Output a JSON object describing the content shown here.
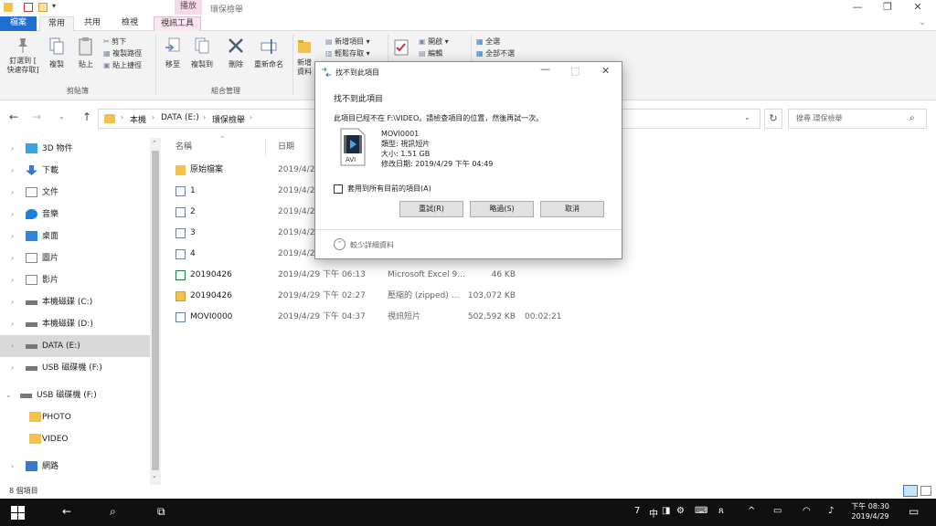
{
  "window": {
    "context_header": "播放",
    "title": "環保檢舉",
    "controls": [
      "—",
      "❐",
      "✕"
    ]
  },
  "ribbon_tabs": [
    "檔案",
    "常用",
    "共用",
    "檢視",
    "視訊工具"
  ],
  "ribbon": {
    "clipboard": {
      "pin_label": "釘選到 [\n快速存取]",
      "copy_label": "複製",
      "paste_label": "貼上",
      "cut_label": "剪下",
      "copy_path_label": "複製路徑",
      "paste_shortcut_label": "貼上捷徑",
      "group_label": "剪貼簿"
    },
    "organize": {
      "move_label": "移至",
      "copyto_label": "複製到",
      "delete_label": "刪除",
      "rename_label": "重新命名",
      "group_label": "組合管理"
    },
    "new": {
      "new_folder_label": "新增\n資料",
      "new_item_label": "新增項目 ▾",
      "easy_access_label": "輕鬆存取 ▾"
    },
    "open": {
      "open_label": "開啟 ▾",
      "edit_label": "編輯"
    },
    "select": {
      "select_all_label": "全選",
      "select_none_label": "全部不選"
    }
  },
  "address": {
    "path": [
      "本機",
      "DATA (E:)",
      "環保檢舉"
    ],
    "search_placeholder": "搜尋 環保檢舉"
  },
  "nav": [
    {
      "label": "3D 物件",
      "icon": "cube-icon",
      "sel": false
    },
    {
      "label": "下載",
      "icon": "download-icon",
      "sel": false
    },
    {
      "label": "文件",
      "icon": "document-icon",
      "sel": false
    },
    {
      "label": "音樂",
      "icon": "music-icon",
      "sel": false
    },
    {
      "label": "桌面",
      "icon": "desktop-icon",
      "sel": false
    },
    {
      "label": "圖片",
      "icon": "pictures-icon",
      "sel": false
    },
    {
      "label": "影片",
      "icon": "video-icon",
      "sel": false
    },
    {
      "label": "本機磁碟 (C:)",
      "icon": "drive-icon",
      "sel": false
    },
    {
      "label": "本機磁碟 (D:)",
      "icon": "drive-icon",
      "sel": false
    },
    {
      "label": "DATA (E:)",
      "icon": "drive-icon",
      "sel": true
    },
    {
      "label": "USB 磁碟機 (F:)",
      "icon": "usb-drive-icon",
      "sel": false
    },
    {
      "label": "USB 磁碟機 (F:)",
      "icon": "usb-drive-icon",
      "sel": false
    },
    {
      "label": "PHOTO",
      "icon": "folder-icon",
      "sel": false
    },
    {
      "label": "VIDEO",
      "icon": "folder-icon",
      "sel": false
    },
    {
      "label": "網路",
      "icon": "network-icon",
      "sel": false
    }
  ],
  "columns": {
    "name": "名稱",
    "date": "日期"
  },
  "files": [
    {
      "name": "原始檔案",
      "date": "2019/4/2",
      "type": "",
      "size": "",
      "length": "",
      "icon": "folder"
    },
    {
      "name": "1",
      "date": "2019/4/2",
      "type": "",
      "size": "",
      "length": "",
      "icon": "doc"
    },
    {
      "name": "2",
      "date": "2019/4/2",
      "type": "",
      "size": "",
      "length": "",
      "icon": "doc"
    },
    {
      "name": "3",
      "date": "2019/4/2",
      "type": "",
      "size": "",
      "length": "",
      "icon": "doc"
    },
    {
      "name": "4",
      "date": "2019/4/2",
      "type": "",
      "size": "",
      "length": "",
      "icon": "doc"
    },
    {
      "name": "20190426",
      "date": "2019/4/29 下午 06:13",
      "type": "Microsoft Excel 9...",
      "size": "46 KB",
      "length": "",
      "icon": "excel"
    },
    {
      "name": "20190426",
      "date": "2019/4/29 下午 02:27",
      "type": "壓縮的 (zipped) ...",
      "size": "103,072 KB",
      "length": "",
      "icon": "zip"
    },
    {
      "name": "MOVI0000",
      "date": "2019/4/29 下午 04:37",
      "type": "視訊短片",
      "size": "502,592 KB",
      "length": "00:02:21",
      "icon": "video"
    }
  ],
  "status": {
    "count": "8 個項目"
  },
  "dialog": {
    "title": "找不到此項目",
    "heading": "找不到此項目",
    "message": "此項目已經不在 F:\\VIDEO。請檢查項目的位置，然後再試一次。",
    "file_name": "MOVI0001",
    "file_type": "類型: 視訊短片",
    "file_size": "大小: 1.51 GB",
    "file_modified": "修改日期: 2019/4/29 下午 04:49",
    "file_badge": "AVI",
    "apply_all_label": "套用到所有目前的項目(A)",
    "retry_label": "重試(R)",
    "skip_label": "略過(S)",
    "cancel_label": "取消",
    "less_details_label": "較少詳細資料"
  },
  "taskbar": {
    "ime_lang": "中",
    "time": "下午 08:30",
    "date": "2019/4/29",
    "small_num": "7"
  }
}
